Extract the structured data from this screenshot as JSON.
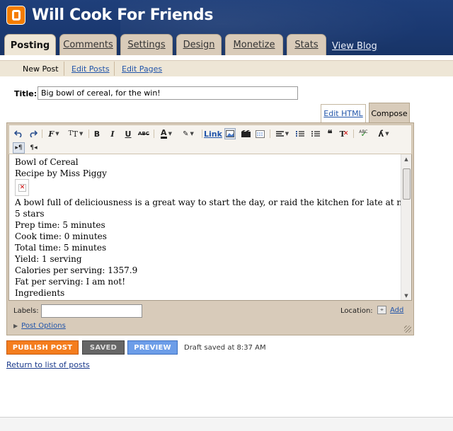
{
  "header": {
    "blog_title": "Will Cook For Friends",
    "brand_color": "#f57d00",
    "tabs": [
      {
        "label": "Posting",
        "active": true
      },
      {
        "label": "Comments",
        "active": false
      },
      {
        "label": "Settings",
        "active": false
      },
      {
        "label": "Design",
        "active": false
      },
      {
        "label": "Monetize",
        "active": false
      },
      {
        "label": "Stats",
        "active": false
      }
    ],
    "view_blog": "View Blog"
  },
  "subnav": {
    "items": [
      {
        "label": "New Post",
        "active": true
      },
      {
        "label": "Edit Posts",
        "active": false
      },
      {
        "label": "Edit Pages",
        "active": false
      }
    ]
  },
  "post": {
    "title_label": "Title:",
    "title_value": "Big bowl of cereal, for the win!"
  },
  "editor": {
    "mode_tabs": {
      "edit_html": "Edit HTML",
      "compose": "Compose"
    },
    "toolbar": {
      "link": "Link"
    },
    "content_lines": [
      "Bowl of Cereal",
      "Recipe by Miss Piggy",
      "A bowl full of deliciousness is a great way to start the day, or raid the kitchen for late at night.",
      "5 stars",
      "Prep time: 5 minutes",
      "Cook time: 0 minutes",
      "Total time: 5 minutes",
      "Yield: 1 serving",
      "Calories per serving: 1357.9",
      "Fat per serving: I am not!",
      "Ingredients"
    ],
    "labels_label": "Labels:",
    "labels_value": "",
    "location_label": "Location:",
    "location_add": "Add",
    "post_options": "Post Options"
  },
  "actions": {
    "publish": "PUBLISH POST",
    "saved": "SAVED",
    "preview": "PREVIEW",
    "draft_status": "Draft saved at 8:37 AM",
    "return_link": "Return to list of posts"
  }
}
